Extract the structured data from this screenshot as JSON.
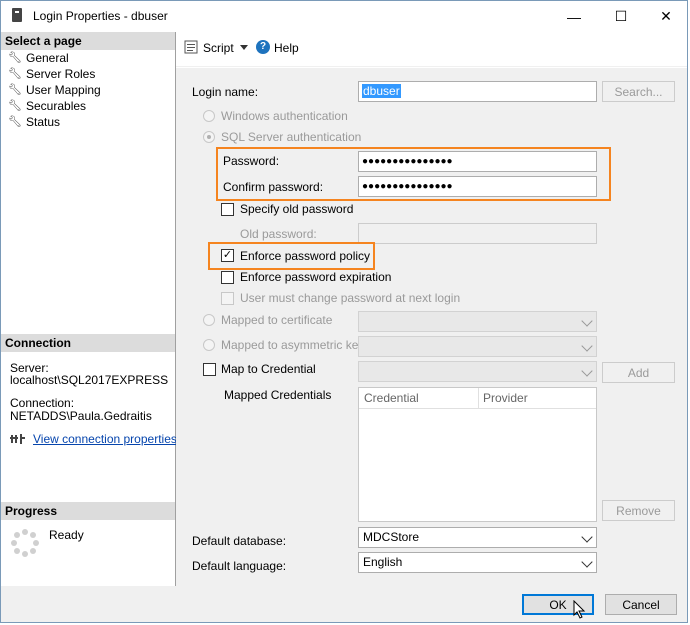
{
  "window": {
    "title": "Login Properties - dbuser",
    "minimize_glyph": "—",
    "maximize_glyph": "☐",
    "close_glyph": "✕"
  },
  "left_pane": {
    "select_page_heading": "Select a page",
    "pages": [
      {
        "label": "General",
        "icon": "wrench-icon"
      },
      {
        "label": "Server Roles",
        "icon": "wrench-icon"
      },
      {
        "label": "User Mapping",
        "icon": "wrench-icon"
      },
      {
        "label": "Securables",
        "icon": "wrench-icon"
      },
      {
        "label": "Status",
        "icon": "wrench-icon"
      }
    ],
    "connection_heading": "Connection",
    "server_label": "Server:",
    "server_value": "localhost\\SQL2017EXPRESS",
    "connection_label": "Connection:",
    "connection_value": "NETADDS\\Paula.Gedraitis",
    "view_connection_link": "View connection properties",
    "progress_heading": "Progress",
    "progress_status": "Ready"
  },
  "toolbar": {
    "script_label": "Script",
    "help_label": "Help"
  },
  "form": {
    "login_name_label": "Login name:",
    "login_name_value": "dbuser",
    "search_button": "Search...",
    "windows_auth_label": "Windows authentication",
    "sql_auth_label": "SQL Server authentication",
    "password_label": "Password:",
    "password_value": "●●●●●●●●●●●●●●●",
    "confirm_password_label": "Confirm password:",
    "confirm_password_value": "●●●●●●●●●●●●●●●",
    "specify_old_password_label": "Specify old password",
    "old_password_label": "Old password:",
    "enforce_policy_label": "Enforce password policy",
    "enforce_policy_checked": "✓",
    "enforce_expiration_label": "Enforce password expiration",
    "must_change_label": "User must change password at next login",
    "mapped_cert_label": "Mapped to certificate",
    "mapped_asym_label": "Mapped to asymmetric key",
    "map_credential_label": "Map to Credential",
    "add_button": "Add",
    "mapped_credentials_label": "Mapped Credentials",
    "credentials_columns": [
      "Credential",
      "Provider"
    ],
    "remove_button": "Remove",
    "default_database_label": "Default database:",
    "default_database_value": "MDCStore",
    "default_language_label": "Default language:",
    "default_language_value": "English"
  },
  "footer": {
    "ok_button": "OK",
    "cancel_button": "Cancel"
  },
  "colors": {
    "highlight": "#f5841f",
    "link": "#0645ad",
    "selection": "#3399ff"
  }
}
